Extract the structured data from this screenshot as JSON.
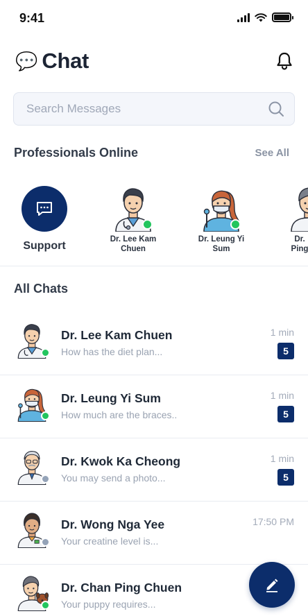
{
  "status_bar": {
    "time": "9:41"
  },
  "header": {
    "emoji": "💬",
    "title": "Chat"
  },
  "search": {
    "placeholder": "Search Messages"
  },
  "professionals": {
    "title": "Professionals Online",
    "see_all": "See All",
    "support_label": "Support",
    "items": [
      {
        "name": "Dr. Lee Kam Chuen"
      },
      {
        "name": "Dr. Leung Yi Sum"
      },
      {
        "name": "Dr. Ping"
      }
    ]
  },
  "all_chats": {
    "title": "All Chats",
    "items": [
      {
        "name": "Dr. Lee Kam Chuen",
        "preview": "How has the diet plan...",
        "time": "1 min",
        "unread": "5",
        "status": "online"
      },
      {
        "name": "Dr. Leung Yi Sum",
        "preview": "How much are the braces..",
        "time": "1 min",
        "unread": "5",
        "status": "online"
      },
      {
        "name": "Dr. Kwok Ka Cheong",
        "preview": "You may send a photo...",
        "time": "1 min",
        "unread": "5",
        "status": "offline"
      },
      {
        "name": "Dr. Wong Nga Yee",
        "preview": "Your creatine level is...",
        "time": "17:50 PM",
        "unread": "",
        "status": "offline"
      },
      {
        "name": "Dr. Chan Ping Chuen",
        "preview": "Your puppy requires...",
        "time": "",
        "unread": "",
        "status": "online"
      }
    ]
  },
  "colors": {
    "brand": "#0c2d6b",
    "online": "#22c55e",
    "offline": "#94a3b8"
  }
}
